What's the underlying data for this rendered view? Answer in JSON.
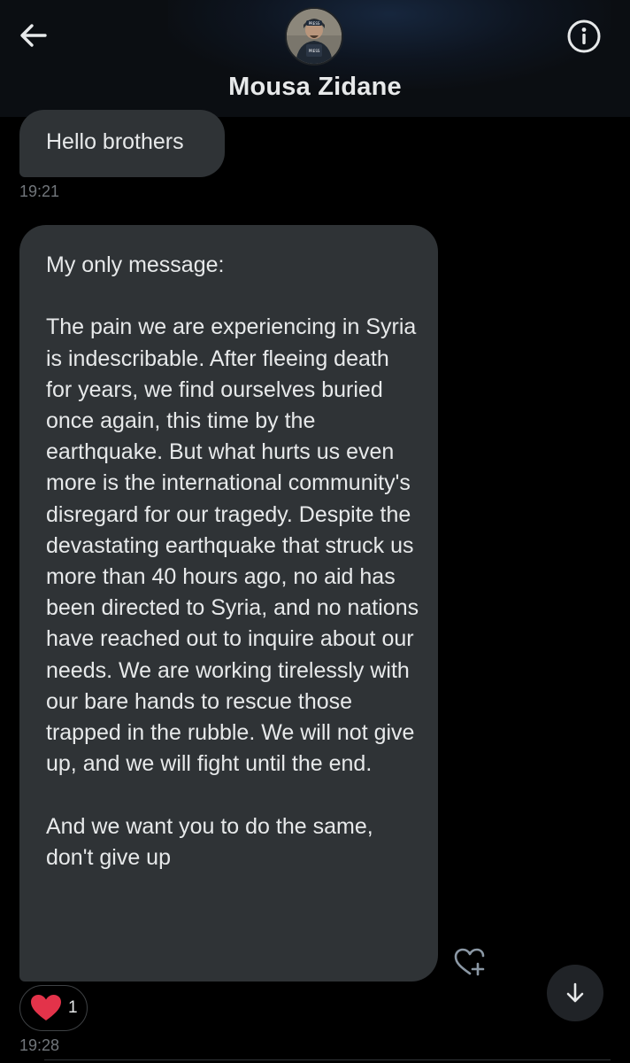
{
  "header": {
    "contact_name": "Mousa Zidane",
    "back_icon": "arrow-left-icon",
    "info_icon": "info-icon",
    "avatar": {
      "badge_text": "PRESS"
    }
  },
  "messages": [
    {
      "text": "Hello brothers",
      "time": "19:21"
    },
    {
      "text": "My only message:\n\nThe pain we are experiencing in Syria is indescribable. After fleeing death for years, we find ourselves buried once again, this time by the earthquake. But what hurts us even more is the international community's disregard for our tragedy. Despite the devastating earthquake that struck us more than 40 hours ago, no aid has been directed to Syria, and no nations have reached out to inquire about our needs. We are working tirelessly with our bare hands to rescue those trapped in the rubble. We will not give up, and we will fight until the end.\n\nAnd we want you to do the same, don't give up",
      "time": "19:28",
      "reaction": {
        "icon": "heart-icon",
        "count": "1",
        "color": "#f91880"
      },
      "add_reaction_icon": "heart-plus-icon"
    }
  ],
  "scroll_down_icon": "arrow-down-icon",
  "colors": {
    "background": "#000000",
    "bubble": "#2f3336",
    "text": "#e7e9ea",
    "timestamp": "#71767b"
  }
}
